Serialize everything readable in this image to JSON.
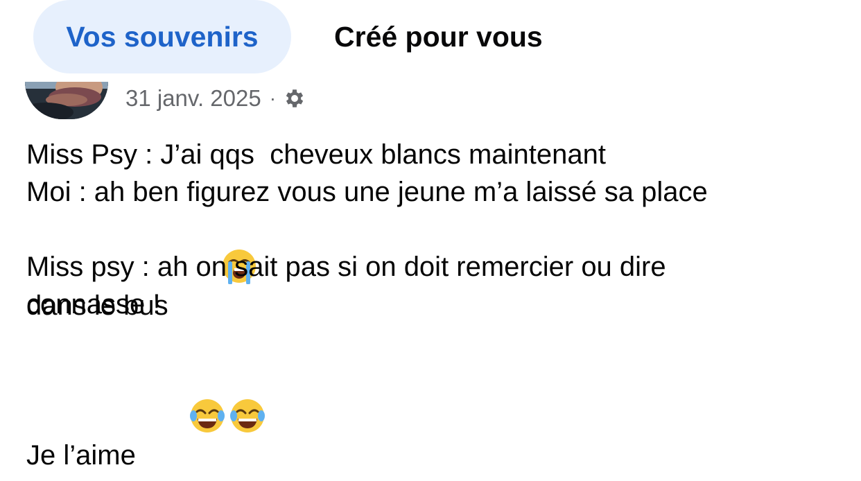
{
  "tabs": {
    "memories_label": "Vos souvenirs",
    "created_for_you_label": "Créé pour vous"
  },
  "post": {
    "date": "31 janv. 2025",
    "separator": "·",
    "privacy_icon": "gear-icon",
    "lines": [
      "Miss Psy : J’ai qqs  cheveux blancs maintenant",
      "Moi : ah ben figurez vous une jeune m’a laissé sa place",
      "dans le bus",
      "Miss psy : ah on sait pas si on doit remercier ou dire",
      "connasse !",
      "",
      "Je l’aime"
    ],
    "emojis": {
      "line3": "loudly-crying-face",
      "line7": [
        "face-with-tears-of-joy",
        "face-with-tears-of-joy"
      ]
    }
  },
  "colors": {
    "active_tab_bg": "#e7f0fd",
    "active_tab_text": "#1e63c9",
    "meta_text": "#65676b",
    "body_text": "#050505"
  }
}
